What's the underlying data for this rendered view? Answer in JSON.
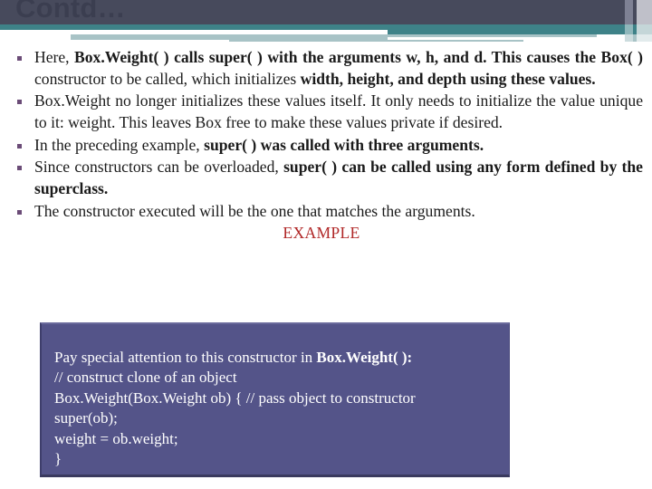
{
  "slide": {
    "title": "Contd…",
    "example_heading": "EXAMPLE",
    "bullets": [
      {
        "runs": [
          {
            "t": "Here, ",
            "bold": false
          },
          {
            "t": "Box.Weight( ) calls super( ) with the arguments w, h, and d. This causes the Box( )",
            "bold": true
          },
          {
            "t": " constructor to be called, which initializes ",
            "bold": false
          },
          {
            "t": "width, height, and depth using these values.",
            "bold": true
          }
        ]
      },
      {
        "runs": [
          {
            "t": "Box.Weight no longer initializes these values itself. It only needs to initialize the value unique to it: weight. This leaves Box free to make these values private if desired.",
            "bold": false
          }
        ]
      },
      {
        "runs": [
          {
            "t": "In the preceding example, ",
            "bold": false
          },
          {
            "t": "super( ) was called with three arguments.",
            "bold": true
          }
        ]
      },
      {
        "runs": [
          {
            "t": "Since constructors can be overloaded, ",
            "bold": false
          },
          {
            "t": "super( ) can be called using any form defined by the superclass.",
            "bold": true
          }
        ]
      },
      {
        "runs": [
          {
            "t": "The constructor executed will be the one that matches the arguments.",
            "bold": false
          }
        ]
      }
    ],
    "code_box": {
      "lines": [
        [
          {
            "t": "Pay special attention to this constructor in ",
            "bold": false
          },
          {
            "t": "Box.Weight( ):",
            "bold": true
          }
        ],
        [
          {
            "t": "// construct clone of an object",
            "bold": false
          }
        ],
        [
          {
            "t": "Box.Weight(Box.Weight ob) { // pass object to constructor",
            "bold": false
          }
        ],
        [
          {
            "t": "super(ob);",
            "bold": false
          }
        ],
        [
          {
            "t": "weight = ob.weight;",
            "bold": false
          }
        ],
        [
          {
            "t": "}",
            "bold": false
          }
        ]
      ]
    }
  },
  "colors": {
    "header_navy": "#474A5C",
    "header_teal": "#3E8288",
    "header_pale": "#A8C3C6",
    "bullet_marker": "#6B4C77",
    "example_red": "#B02727",
    "code_box_fill": "#545489",
    "code_text": "#FFFFFF",
    "body_text": "#1a1a1a"
  }
}
